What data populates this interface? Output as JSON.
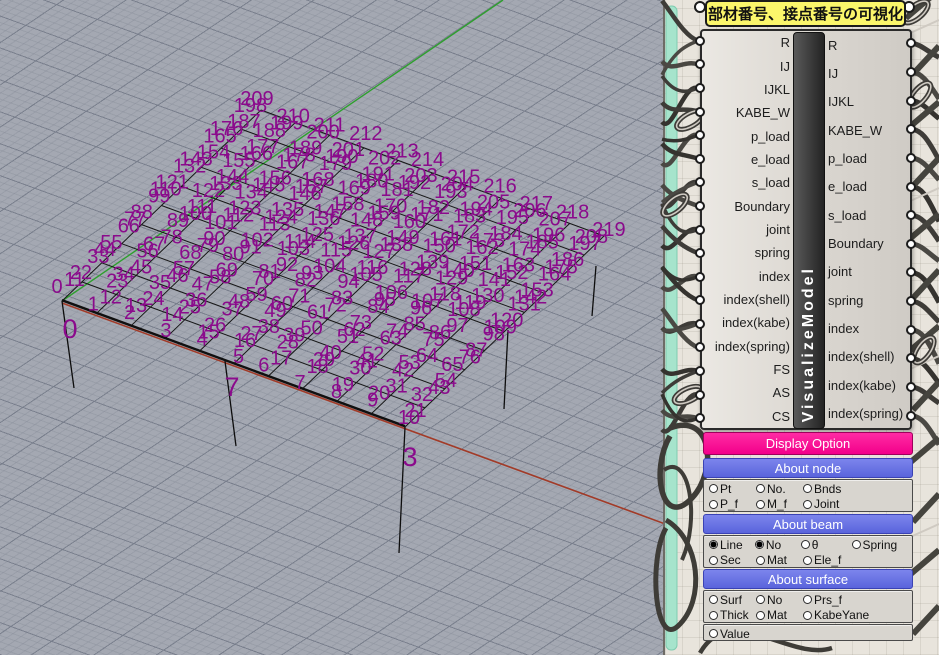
{
  "viewport": {
    "background_color": "#A4A8B2",
    "label_color": "#8B0B8C",
    "x_axis_color": "#A23B28",
    "y_axis_color": "#2E9F2E",
    "grid_rows": 20,
    "grid_cols": 11,
    "column_labels": [
      "0",
      "7",
      "3"
    ],
    "node_labels": [
      0,
      1,
      2,
      3,
      4,
      5,
      6,
      7,
      8,
      9,
      10,
      11,
      12,
      13,
      14,
      15,
      16,
      17,
      18,
      19,
      20,
      21,
      22,
      23,
      24,
      25,
      26,
      27,
      28,
      29,
      30,
      31,
      32,
      33,
      34,
      35,
      36,
      37,
      38,
      39,
      40,
      41,
      42,
      43,
      44,
      45,
      46,
      47,
      48,
      49,
      50,
      51,
      52,
      53,
      54,
      55,
      56,
      57,
      58,
      59,
      60,
      61,
      62,
      63,
      64,
      65,
      66,
      67,
      68,
      69,
      70,
      71,
      72,
      73,
      74,
      75,
      76,
      77,
      78,
      79,
      80,
      81,
      82,
      83,
      84,
      85,
      86,
      87,
      88,
      89,
      90,
      91,
      92,
      93,
      94,
      95,
      96,
      97,
      98,
      99,
      100,
      101,
      102,
      103,
      104,
      105,
      106,
      107,
      108,
      109,
      110,
      111,
      112,
      113,
      114,
      115,
      116,
      117,
      118,
      119,
      120,
      121,
      122,
      123,
      124,
      125,
      126,
      127,
      128,
      129,
      130,
      131,
      132,
      133,
      134,
      135,
      136,
      137,
      138,
      139,
      140,
      141,
      142,
      143,
      144,
      145,
      146,
      147,
      148,
      149,
      150,
      151,
      152,
      153,
      154,
      155,
      156,
      157,
      158,
      159,
      160,
      161,
      162,
      163,
      164,
      165,
      166,
      167,
      168,
      169,
      170,
      171,
      172,
      173,
      174,
      175,
      176,
      177,
      178,
      179,
      180,
      181,
      182,
      183,
      184,
      185,
      186,
      187,
      188,
      189,
      190,
      191,
      192,
      193,
      194,
      195,
      196,
      197,
      198,
      199,
      200,
      201,
      202,
      203,
      204,
      205,
      206,
      207,
      208,
      209,
      210,
      211,
      212,
      213,
      214,
      215,
      216,
      217,
      218,
      219
    ]
  },
  "component": {
    "tooltip": "部材番号、接点番号の可視化",
    "name": "VisualizeModel",
    "inputs": [
      "R",
      "IJ",
      "IJKL",
      "KABE_W",
      "p_load",
      "e_load",
      "s_load",
      "Boundary",
      "joint",
      "spring",
      "index",
      "index(shell)",
      "index(kabe)",
      "index(spring)",
      "FS",
      "AS",
      "CS"
    ],
    "outputs": [
      "R",
      "IJ",
      "IJKL",
      "KABE_W",
      "p_load",
      "e_load",
      "s_load",
      "Boundary",
      "joint",
      "spring",
      "index",
      "index(shell)",
      "index(kabe)",
      "index(spring)"
    ],
    "display_option_label": "Display Option",
    "accent_colors": {
      "display_option": "#F3008A",
      "section_header": "#6B74E0"
    },
    "sections": [
      {
        "title": "About node",
        "rows": [
          [
            {
              "label": "Pt",
              "checked": false
            },
            {
              "label": "No.",
              "checked": false
            },
            {
              "label": "Bnds",
              "checked": false
            }
          ],
          [
            {
              "label": "P_f",
              "checked": false
            },
            {
              "label": "M_f",
              "checked": false
            },
            {
              "label": "Joint",
              "checked": false
            }
          ]
        ]
      },
      {
        "title": "About beam",
        "rows": [
          [
            {
              "label": "Line",
              "checked": true
            },
            {
              "label": "No",
              "checked": true
            },
            {
              "label": "θ",
              "checked": false
            },
            {
              "label": "Spring",
              "checked": false
            }
          ],
          [
            {
              "label": "Sec",
              "checked": false
            },
            {
              "label": "Mat",
              "checked": false
            },
            {
              "label": "Ele_f",
              "checked": false
            }
          ]
        ]
      },
      {
        "title": "About surface",
        "rows": [
          [
            {
              "label": "Surf",
              "checked": false
            },
            {
              "label": "No",
              "checked": false
            },
            {
              "label": "Prs_f",
              "checked": false
            }
          ],
          [
            {
              "label": "Thick",
              "checked": false
            },
            {
              "label": "Mat",
              "checked": false
            },
            {
              "label": "KabeYane",
              "checked": false
            }
          ]
        ]
      }
    ],
    "value_option": {
      "label": "Value",
      "checked": false
    }
  }
}
